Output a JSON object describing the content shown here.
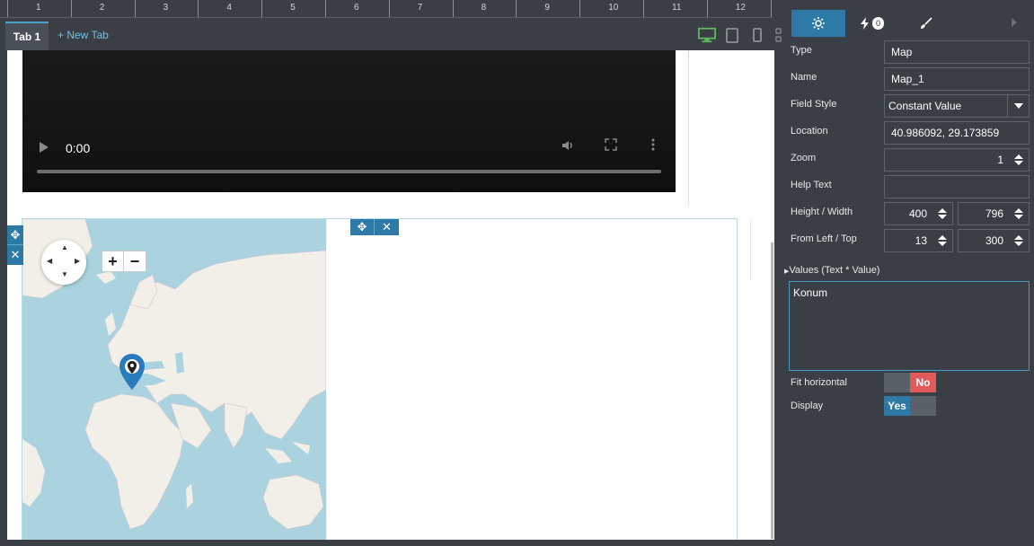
{
  "ruler": {
    "numbers": [
      "1",
      "2",
      "3",
      "4",
      "5",
      "6",
      "7",
      "8",
      "9",
      "10",
      "11",
      "12"
    ]
  },
  "tabs": {
    "active": "Tab 1",
    "new_tab": "+ New Tab"
  },
  "video": {
    "time": "0:00"
  },
  "panel": {
    "badge_count": "0",
    "type": {
      "label": "Type",
      "value": "Map"
    },
    "name": {
      "label": "Name",
      "value": "Map_1"
    },
    "field_style": {
      "label": "Field Style",
      "value": "Constant Value"
    },
    "location": {
      "label": "Location",
      "value": "40.986092, 29.173859"
    },
    "zoom": {
      "label": "Zoom",
      "value": "1"
    },
    "help_text": {
      "label": "Help Text",
      "value": ""
    },
    "height_width": {
      "label": "Height / Width",
      "height": "400",
      "width": "796"
    },
    "from_left_top": {
      "label": "From Left / Top",
      "left": "13",
      "top": "300"
    },
    "values": {
      "label": "Values (Text * Value)",
      "text": "Konum"
    },
    "fit_horizontal": {
      "label": "Fit horizontal",
      "value": "No"
    },
    "display": {
      "label": "Display",
      "value": "Yes"
    }
  },
  "colors": {
    "accent": "#2e7aa6",
    "toggle_no": "#e05a5a",
    "toggle_yes": "#2e7aa6",
    "map_water": "#aad3df",
    "map_land": "#f2efe9"
  },
  "icons": [
    "gear-icon",
    "bolt-icon",
    "brush-icon",
    "desktop-icon",
    "tablet-icon",
    "phone-icon",
    "grid-icon",
    "move-icon",
    "close-icon",
    "map-pin-icon"
  ]
}
